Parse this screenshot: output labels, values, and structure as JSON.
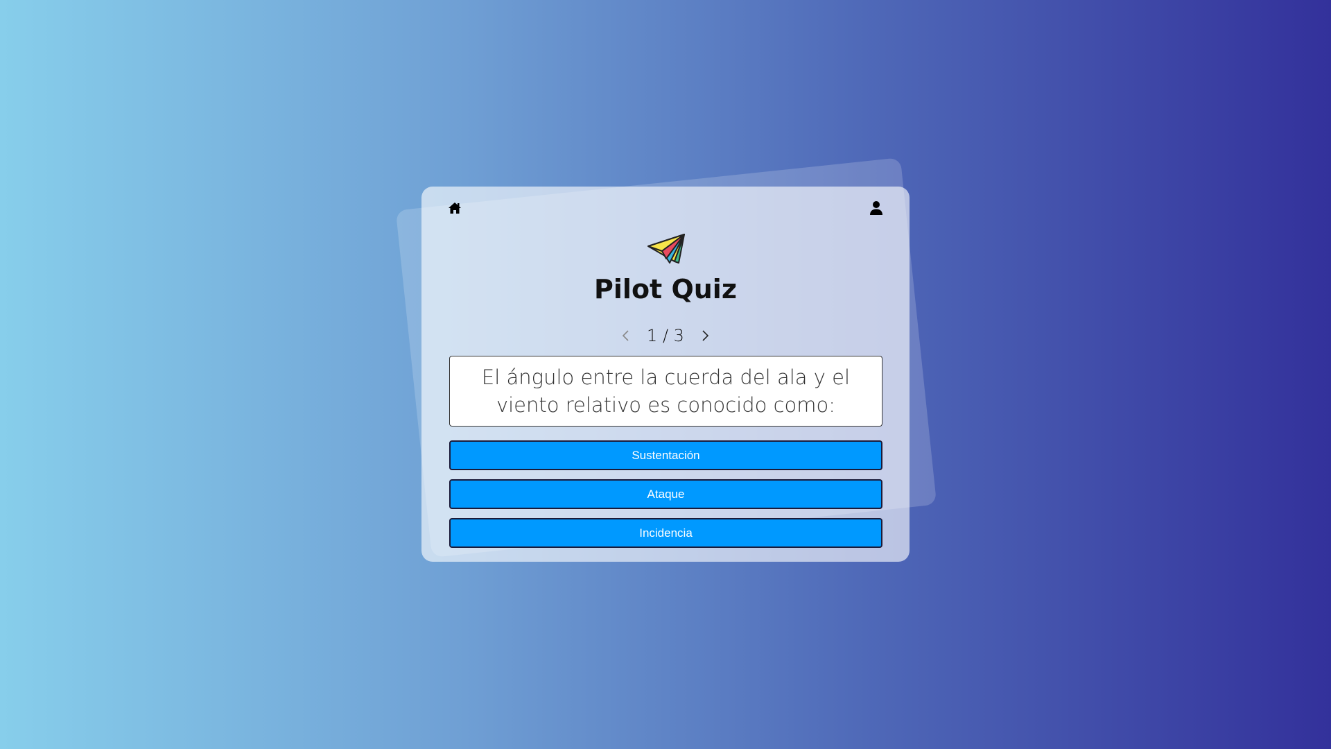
{
  "app": {
    "title": "Pilot Quiz"
  },
  "header": {
    "home_icon": "home-icon",
    "user_icon": "user-icon",
    "logo_icon": "paper-plane-icon"
  },
  "pager": {
    "counter": "1 / 3",
    "prev_icon": "chevron-left-icon",
    "next_icon": "chevron-right-icon"
  },
  "question": {
    "text": "El ángulo entre la cuerda del ala y el viento relativo es conocido como:"
  },
  "answers": [
    {
      "label": "Sustentación"
    },
    {
      "label": "Ataque"
    },
    {
      "label": "Incidencia"
    }
  ],
  "colors": {
    "answer_bg": "#0099ff",
    "gradient_start": "#87ceeb",
    "gradient_end": "#33319b"
  }
}
